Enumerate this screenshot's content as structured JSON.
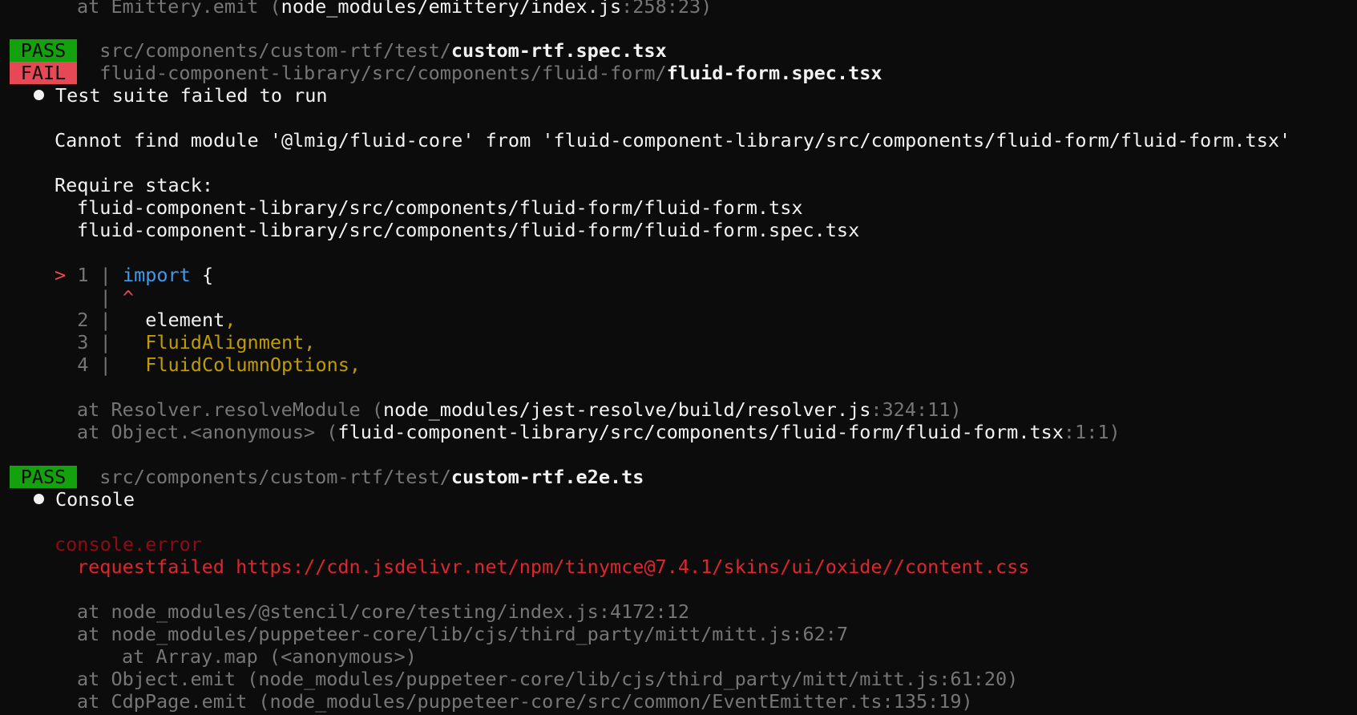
{
  "line_top": {
    "prefix": "at Emittery.emit (",
    "path": "node_modules/emittery/index.js",
    "pos": ":258:23",
    "suffix": ")"
  },
  "suite1": {
    "badge": "PASS",
    "dir": "src/components/custom-rtf/test/",
    "file": "custom-rtf.spec.tsx"
  },
  "suite2": {
    "badge": "FAIL",
    "dir": "fluid-component-library/src/components/fluid-form/",
    "file": "fluid-form.spec.tsx",
    "bullet_text": "Test suite failed to run",
    "message": "Cannot find module '@lmig/fluid-core' from 'fluid-component-library/src/components/fluid-form/fluid-form.tsx'",
    "require_label": "Require stack:",
    "require_stack": [
      "fluid-component-library/src/components/fluid-form/fluid-form.tsx",
      "fluid-component-library/src/components/fluid-form/fluid-form.spec.tsx"
    ],
    "code": {
      "marker": ">",
      "line1_no": "1",
      "line1_kw": "import",
      "line1_rest": " {",
      "caret": "^",
      "line2_no": "2",
      "line2_ident": "element",
      "line3_no": "3",
      "line3_ident": "FluidAlignment",
      "line4_no": "4",
      "line4_ident": "FluidColumnOptions",
      "comma": ",",
      "pipe": "|"
    },
    "trace": [
      {
        "prefix": "at Resolver.resolveModule (",
        "path": "node_modules/jest-resolve/build/resolver.js",
        "pos": ":324:11",
        "suffix": ")"
      },
      {
        "prefix": "at Object.<anonymous> (",
        "path": "fluid-component-library/src/components/fluid-form/fluid-form.tsx",
        "pos": ":1:1",
        "suffix": ")"
      }
    ]
  },
  "suite3": {
    "badge": "PASS",
    "dir": "src/components/custom-rtf/test/",
    "file": "custom-rtf.e2e.ts",
    "bullet_text": "Console",
    "console_label": "console.error",
    "error_msg": "requestfailed https://cdn.jsdelivr.net/npm/tinymce@7.4.1/skins/ui/oxide//content.css",
    "trace": [
      "at node_modules/@stencil/core/testing/index.js:4172:12",
      "at node_modules/puppeteer-core/lib/cjs/third_party/mitt/mitt.js:62:7",
      "at Array.map (<anonymous>)",
      "at Object.emit (node_modules/puppeteer-core/lib/cjs/third_party/mitt/mitt.js:61:20)",
      "at CdpPage.emit (node_modules/puppeteer-core/src/common/EventEmitter.ts:135:19)"
    ]
  }
}
